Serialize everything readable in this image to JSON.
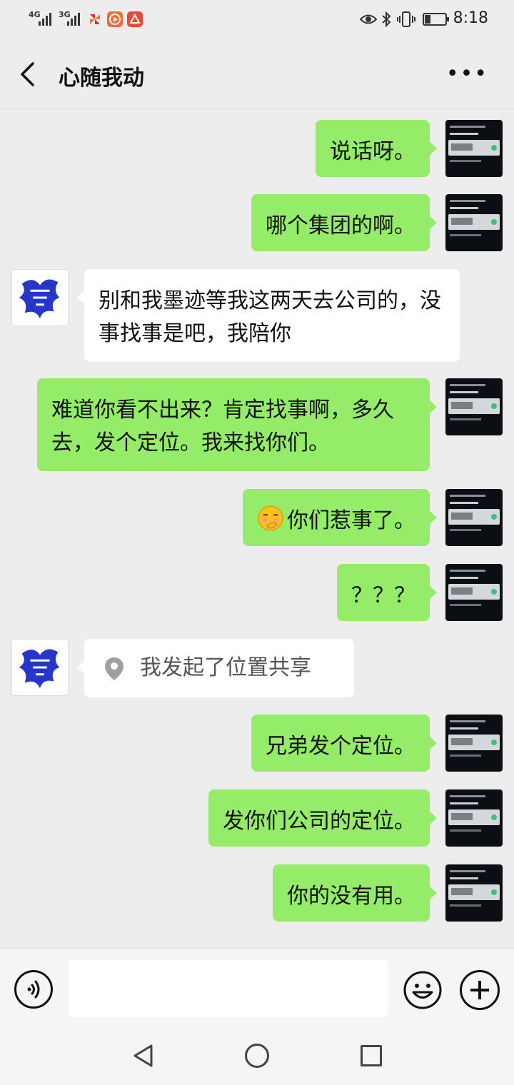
{
  "status_bar": {
    "network_1": "4G",
    "network_2": "3G",
    "time": "8:18",
    "icons": [
      "signal-icon",
      "signal-icon",
      "pinwheel-app-icon",
      "video-app-icon",
      "app-notification-icon",
      "eye-comfort-icon",
      "bluetooth-icon",
      "vibrate-icon",
      "battery-icon"
    ],
    "battery_level": 0.3
  },
  "header": {
    "title": "心随我动",
    "back_icon": "chevron-left-icon",
    "more_label": "•••"
  },
  "messages": [
    {
      "from": "me",
      "text": "说话呀。"
    },
    {
      "from": "me",
      "text": "哪个集团的啊。"
    },
    {
      "from": "other",
      "text": "别和我墨迹等我这两天去公司的，没事找事是吧，我陪你"
    },
    {
      "from": "me",
      "text": "难道你看不出来？肯定找事啊，多久去，发个定位。我来找你们。"
    },
    {
      "from": "me",
      "emoji": "face-with-hand-over-mouth-icon",
      "text": "你们惹事了。"
    },
    {
      "from": "me",
      "text": "？？？"
    },
    {
      "from": "other",
      "type": "location-share",
      "icon": "location-pin-icon",
      "text": "我发起了位置共享"
    },
    {
      "from": "me",
      "text": "兄弟发个定位。"
    },
    {
      "from": "me",
      "text": "发你们公司的定位。"
    },
    {
      "from": "me",
      "text": "你的没有用。"
    }
  ],
  "input_bar": {
    "value": "",
    "icons": [
      "voice-icon",
      "emoji-icon",
      "plus-icon"
    ]
  },
  "system_nav": {
    "icons": [
      "back-icon",
      "home-icon",
      "recent-apps-icon"
    ]
  }
}
